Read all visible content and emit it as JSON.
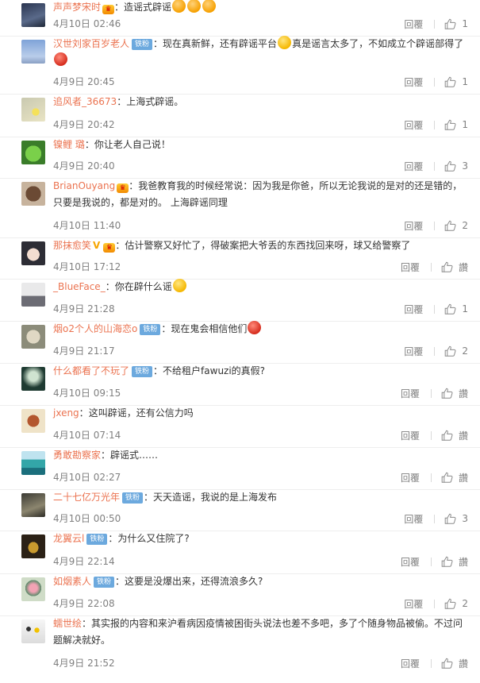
{
  "reply_label": "回覆",
  "zan_label": "讚",
  "tie_fen_label": "铁粉",
  "colon": "：",
  "comments": [
    {
      "username": "声声梦宋时",
      "badge": "crown",
      "text": "造谣式辟谣",
      "emoji_after": [
        "laugh",
        "laugh",
        "laugh"
      ],
      "time": "4月10日 02:46",
      "likes": "1",
      "avatar": "night-sky"
    },
    {
      "username": "汉世刘家百岁老人",
      "badge": "tiefen",
      "text": "现在真新鲜，还有辟谣平台",
      "emoji_mid": "think",
      "text2": "真是谣言太多了，不如成立个辟谣部得了",
      "emoji_after": [
        "red"
      ],
      "time": "4月9日 20:45",
      "likes": "1",
      "avatar": "blue-sky"
    },
    {
      "username": "追风者_36673",
      "badge": "",
      "text": "上海式辟谣。",
      "time": "4月9日 20:42",
      "likes": "1",
      "avatar": "flowers"
    },
    {
      "username": "镍鲤 璐",
      "badge": "",
      "text": "你让老人自己说！",
      "time": "4月9日 20:40",
      "likes": "3",
      "avatar": "cartoon-green"
    },
    {
      "username": "BrianOuyang",
      "badge": "crown",
      "text": "我爸教育我的时候经常说：因为我是你爸，所以无论我说的是对的还是错的，只要是我说的，都是对的。  上海辟谣同理",
      "time": "4月10日 11:40",
      "likes": "2",
      "avatar": "dog"
    },
    {
      "username": "那抹愈笑",
      "badge": "crown-v",
      "vip": "V",
      "text": "估计警察又好忙了，得破案把大爷丢的东西找回来呀，球又给警察了",
      "time": "4月10日 17:12",
      "likes": "讚",
      "avatar": "anime-girl"
    },
    {
      "username": "_BlueFace_",
      "badge": "",
      "text": "你在辟什么谣",
      "emoji_after": [
        "eye"
      ],
      "time": "4月9日 21:28",
      "likes": "1",
      "avatar": "landscape"
    },
    {
      "username": "烟o2个人的山海恋o",
      "badge": "tiefen",
      "text": "现在鬼会相信他们",
      "emoji_after": [
        "red"
      ],
      "time": "4月9日 21:17",
      "likes": "2",
      "avatar": "cat"
    },
    {
      "username": "什么都看了不玩了",
      "badge": "tiefen",
      "text": "不给租户fawuzi的真假?",
      "time": "4月10日 09:15",
      "likes": "讚",
      "avatar": "spotlight"
    },
    {
      "username": "jxeng",
      "badge": "",
      "text": "这叫辟谣，还有公信力吗",
      "time": "4月10日 07:14",
      "likes": "讚",
      "avatar": "figurine"
    },
    {
      "username": "勇敢勘察家",
      "badge": "",
      "text": "辟谣式……",
      "time": "4月10日 02:27",
      "likes": "讚",
      "avatar": "island"
    },
    {
      "username": "二十七亿万光年",
      "badge": "tiefen",
      "text": "天天造谣，我说的是上海发布",
      "time": "4月10日 00:50",
      "likes": "3",
      "avatar": "tree"
    },
    {
      "username": "龙翼云l",
      "badge": "tiefen",
      "text": "为什么又住院了?",
      "time": "4月9日 22:14",
      "likes": "讚",
      "avatar": "dark-bowl"
    },
    {
      "username": "如烟素人",
      "badge": "tiefen",
      "text": "这要是没爆出来，还得流浪多久?",
      "time": "4月9日 22:08",
      "likes": "2",
      "avatar": "lotus"
    },
    {
      "username": "蠕世绘",
      "badge": "",
      "text": "其实报的内容和来沪看病因疫情被困街头说法也差不多吧，多了个随身物品被偷。不过问题解决就好。",
      "time": "4月9日 21:52",
      "likes": "讚",
      "avatar": "people-group"
    }
  ]
}
